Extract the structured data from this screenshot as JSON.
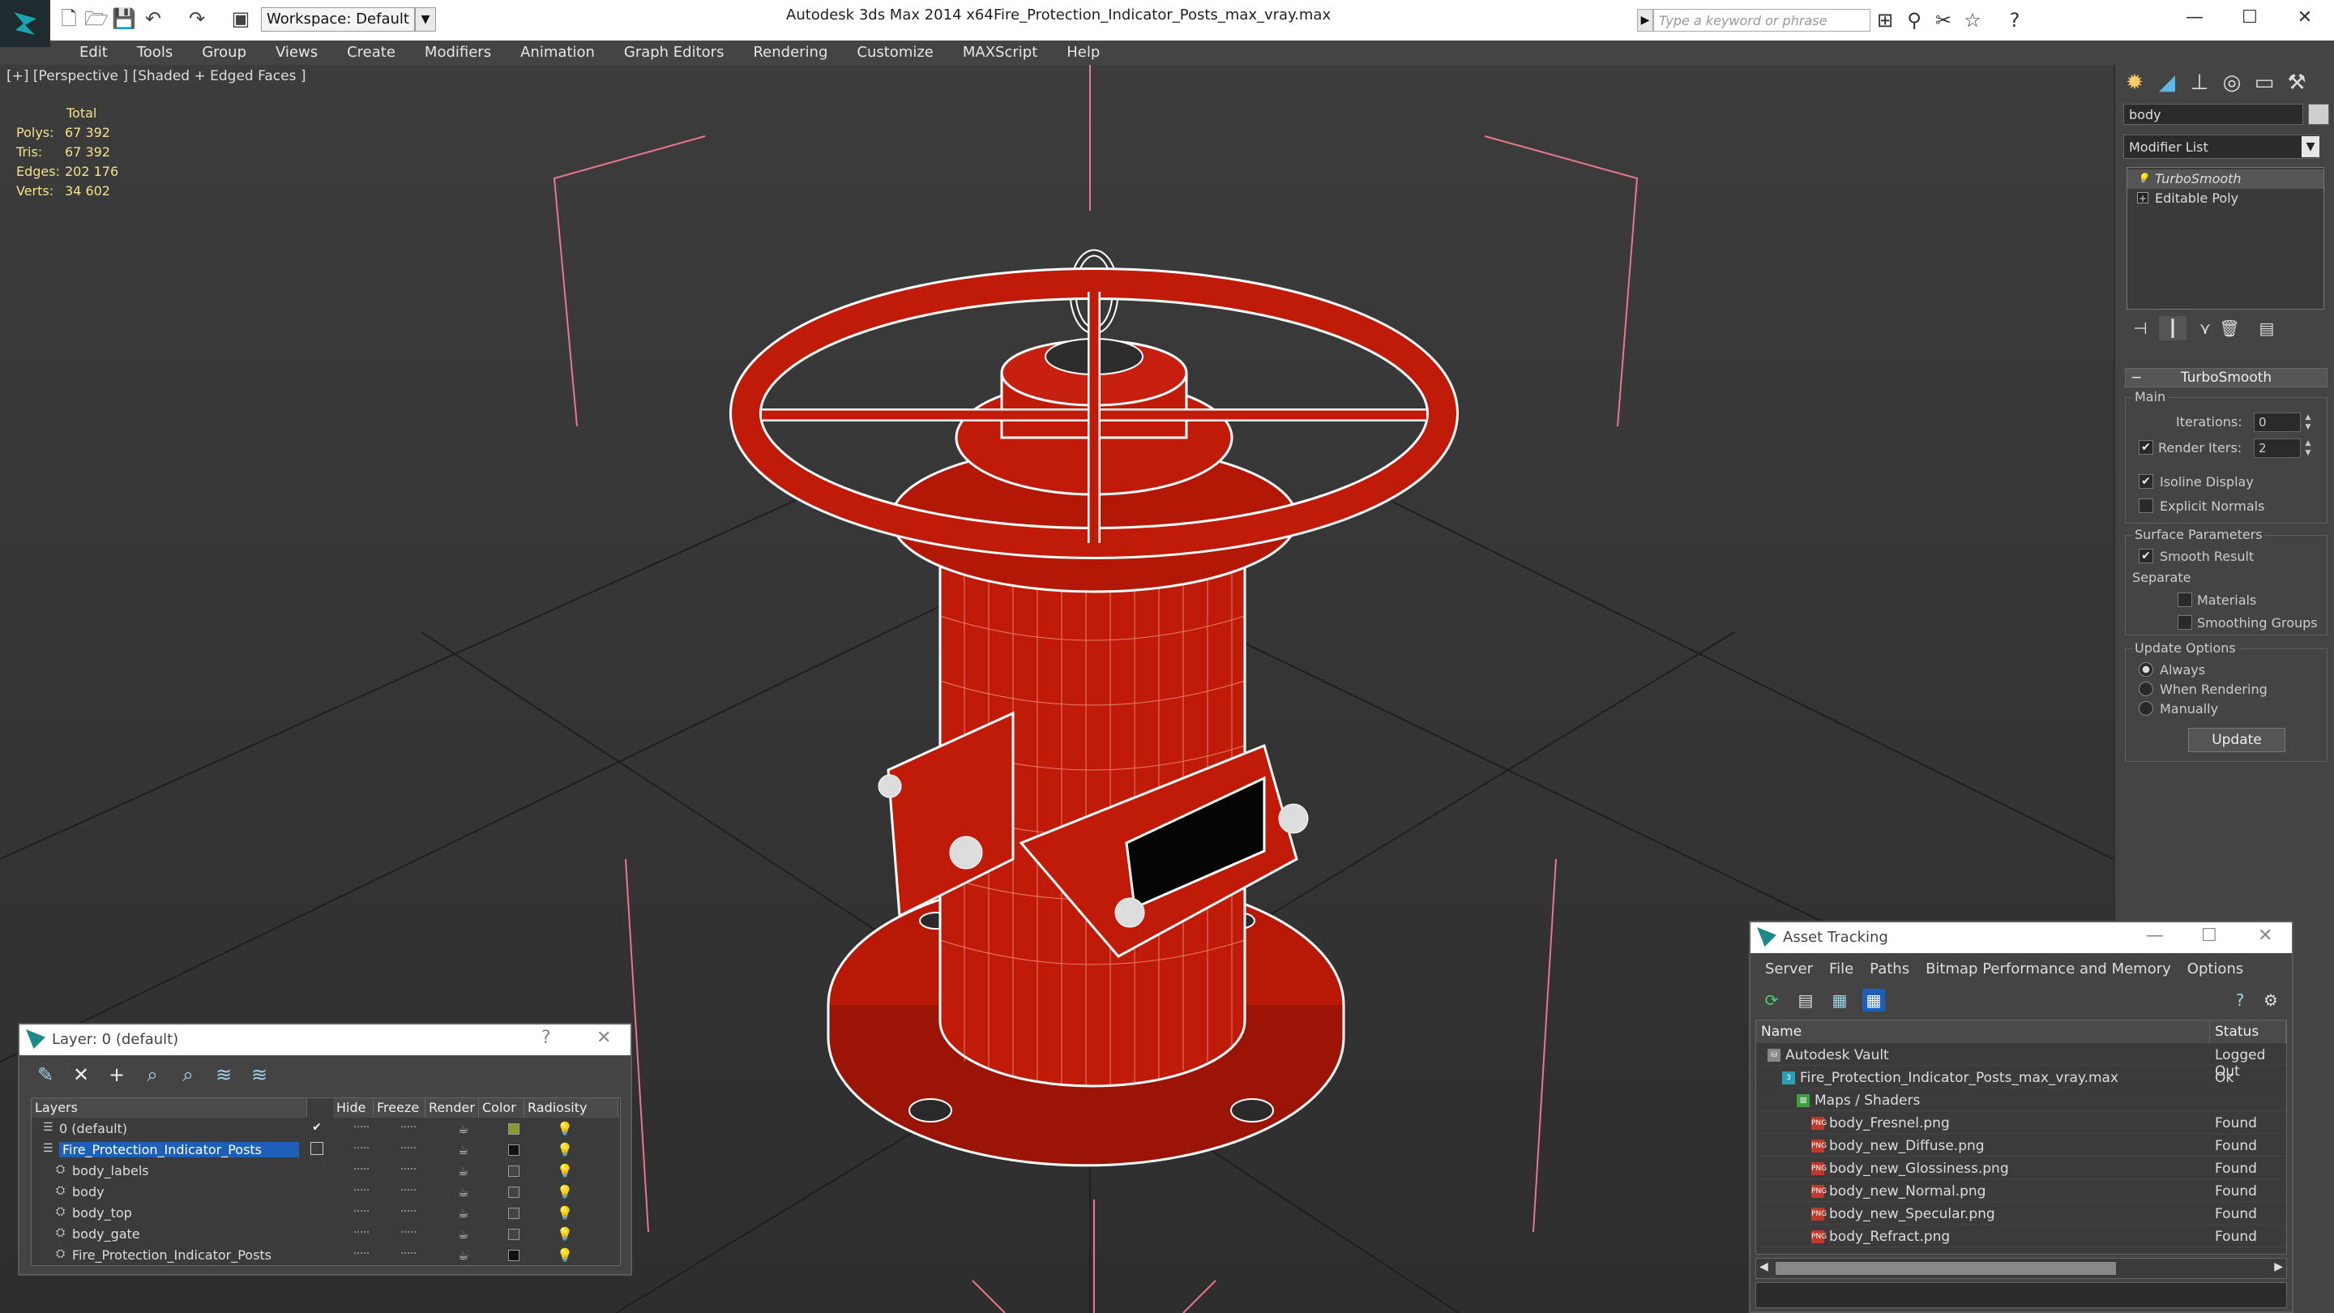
{
  "titlebar": {
    "workspace": "Workspace: Default",
    "app_title": "Autodesk 3ds Max  2014 x64",
    "file_title": "Fire_Protection_Indicator_Posts_max_vray.max",
    "search_placeholder": "Type a keyword or phrase"
  },
  "menubar": [
    "Edit",
    "Tools",
    "Group",
    "Views",
    "Create",
    "Modifiers",
    "Animation",
    "Graph Editors",
    "Rendering",
    "Customize",
    "MAXScript",
    "Help"
  ],
  "viewport": {
    "label": "[+] [Perspective ] [Shaded + Edged Faces ]",
    "stats_header": "Total",
    "stats": [
      {
        "label": "Polys:",
        "value": "67 392"
      },
      {
        "label": "Tris:",
        "value": "67 392"
      },
      {
        "label": "Edges:",
        "value": "202 176"
      },
      {
        "label": "Verts:",
        "value": "34 602"
      }
    ]
  },
  "command_panel": {
    "object_name": "body",
    "modifier_list": "Modifier List",
    "stack": [
      "TurboSmooth",
      "Editable Poly"
    ],
    "rollout_title": "TurboSmooth",
    "main_group": "Main",
    "iterations_label": "Iterations:",
    "iterations_value": "0",
    "render_iters_label": "Render Iters:",
    "render_iters_value": "2",
    "isoline_display": "Isoline Display",
    "explicit_normals": "Explicit Normals",
    "surface_group": "Surface Parameters",
    "smooth_result": "Smooth Result",
    "separate_label": "Separate",
    "materials": "Materials",
    "smoothing_groups": "Smoothing Groups",
    "update_group": "Update Options",
    "always": "Always",
    "when_rendering": "When Rendering",
    "manually": "Manually",
    "update_button": "Update"
  },
  "layer_dialog": {
    "title": "Layer: 0 (default)",
    "help": "?",
    "columns": [
      "Layers",
      "Hide",
      "Freeze",
      "Render",
      "Color",
      "Radiosity"
    ],
    "rows": [
      {
        "name": "0 (default)",
        "indent": 0,
        "selected": false,
        "color": "#8a9a30",
        "check": "✔"
      },
      {
        "name": "Fire_Protection_Indicator_Posts",
        "indent": 0,
        "selected": true,
        "color": "#111111",
        "check": ""
      },
      {
        "name": "body_labels",
        "indent": 1,
        "selected": false,
        "color": "#444444",
        "check": ""
      },
      {
        "name": "body",
        "indent": 1,
        "selected": false,
        "color": "#444444",
        "check": ""
      },
      {
        "name": "body_top",
        "indent": 1,
        "selected": false,
        "color": "#444444",
        "check": ""
      },
      {
        "name": "body_gate",
        "indent": 1,
        "selected": false,
        "color": "#444444",
        "check": ""
      },
      {
        "name": "Fire_Protection_Indicator_Posts",
        "indent": 1,
        "selected": false,
        "color": "#111111",
        "check": ""
      }
    ]
  },
  "asset_dialog": {
    "title": "Asset Tracking",
    "menu": [
      "Server",
      "File",
      "Paths",
      "Bitmap Performance and Memory",
      "Options"
    ],
    "columns": [
      "Name",
      "Status"
    ],
    "rows": [
      {
        "name": "Autodesk Vault",
        "status": "Logged Out",
        "level": 0,
        "icon": "vault"
      },
      {
        "name": "Fire_Protection_Indicator_Posts_max_vray.max",
        "status": "Ok",
        "level": 1,
        "icon": "max"
      },
      {
        "name": "Maps / Shaders",
        "status": "",
        "level": 2,
        "icon": "maps"
      },
      {
        "name": "body_Fresnel.png",
        "status": "Found",
        "level": 3,
        "icon": "png"
      },
      {
        "name": "body_new_Diffuse.png",
        "status": "Found",
        "level": 3,
        "icon": "png"
      },
      {
        "name": "body_new_Glossiness.png",
        "status": "Found",
        "level": 3,
        "icon": "png"
      },
      {
        "name": "body_new_Normal.png",
        "status": "Found",
        "level": 3,
        "icon": "png"
      },
      {
        "name": "body_new_Specular.png",
        "status": "Found",
        "level": 3,
        "icon": "png"
      },
      {
        "name": "body_Refract.png",
        "status": "Found",
        "level": 3,
        "icon": "png"
      }
    ]
  },
  "colors": {
    "model_red": "#c01a08",
    "wire": "#ffffff",
    "stats_text": "#f2e38a",
    "selection": "#1f5fb8"
  }
}
